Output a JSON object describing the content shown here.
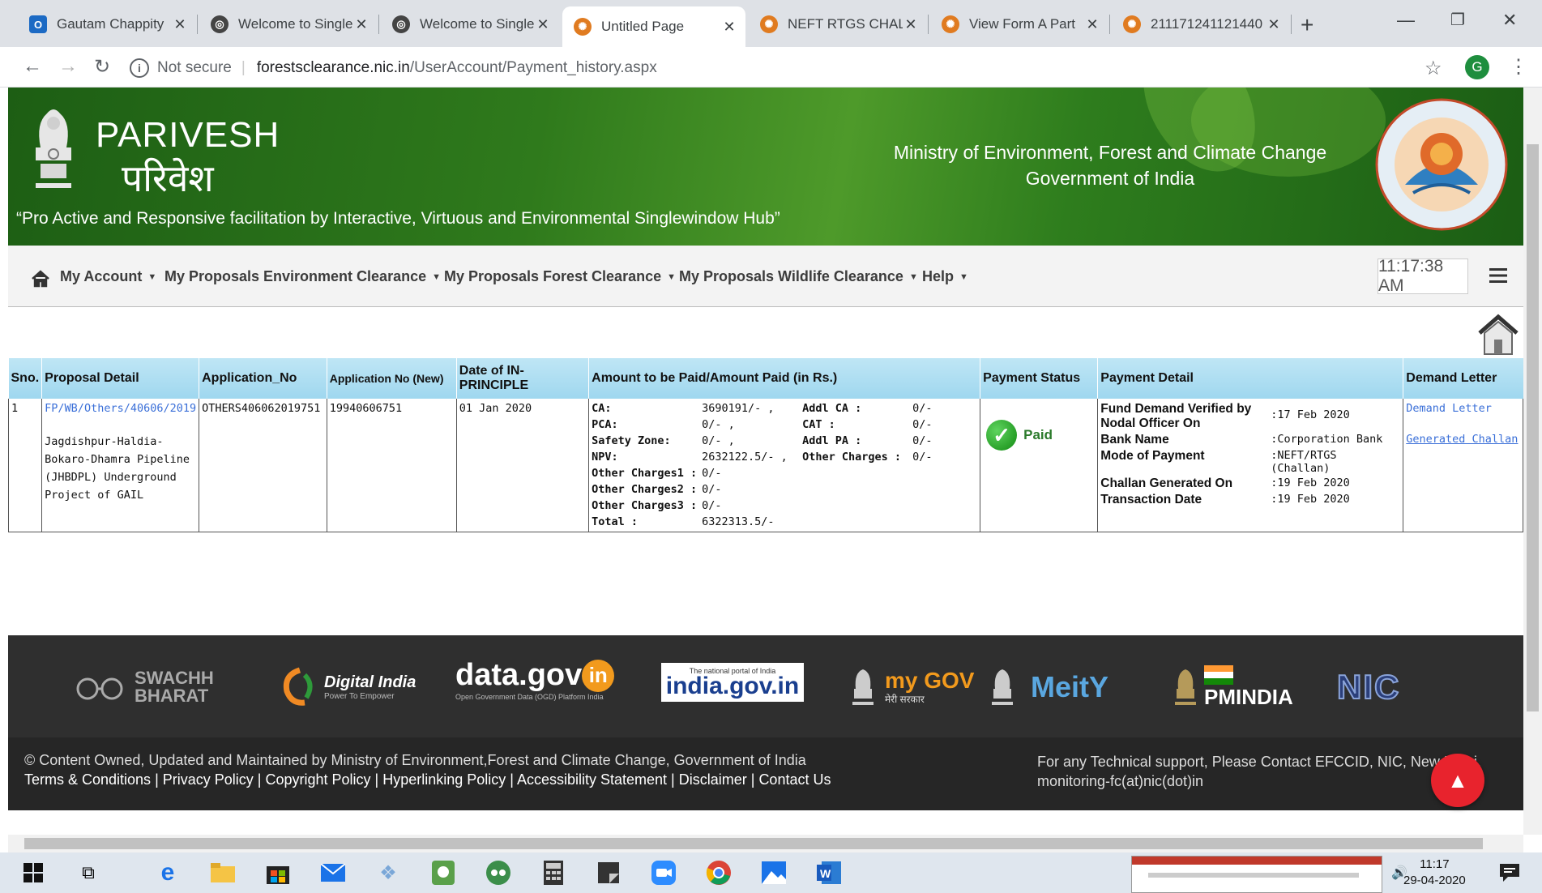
{
  "tabs": [
    {
      "title": "Gautam Chappity",
      "icon_color": "#1c6ac4",
      "icon_glyph": "O"
    },
    {
      "title": "Welcome to Single",
      "icon_color": "#444444",
      "icon_glyph": "◎"
    },
    {
      "title": "Welcome to Single",
      "icon_color": "#444444",
      "icon_glyph": "◎"
    },
    {
      "title": "Untitled Page",
      "icon_color": "#e07b20",
      "icon_glyph": "✺"
    },
    {
      "title": "NEFT RTGS CHALL",
      "icon_color": "#e07b20",
      "icon_glyph": "✺"
    },
    {
      "title": "View Form A Part",
      "icon_color": "#e07b20",
      "icon_glyph": "✺"
    },
    {
      "title": "211171241121440",
      "icon_color": "#e07b20",
      "icon_glyph": "✺"
    }
  ],
  "browser": {
    "security_label": "Not secure",
    "url_host": "forestsclearance.nic.in",
    "url_path": "/UserAccount/Payment_history.aspx",
    "avatar_letter": "G"
  },
  "banner": {
    "brand_en": "PARIVESH",
    "brand_hi": "परिवेश",
    "tagline": "“Pro Active and Responsive facilitation by Interactive, Virtuous and Environmental Singlewindow Hub”",
    "ministry_line1": "Ministry of Environment, Forest and Climate Change",
    "ministry_line2": "Government of India"
  },
  "menu": {
    "items": [
      {
        "label": "My Account"
      },
      {
        "label": "My Proposals Environment Clearance"
      },
      {
        "label": "My Proposals Forest Clearance"
      },
      {
        "label": "My Proposals Wildlife Clearance"
      },
      {
        "label": "Help"
      }
    ],
    "clock": "11:17:38 AM"
  },
  "table": {
    "headers": {
      "sno": "Sno.",
      "proposal": "Proposal Detail",
      "app_no": "Application_No",
      "app_no_new": "Application No (New)",
      "date": "Date of IN-PRINCIPLE",
      "amount": "Amount to be Paid/Amount Paid (in Rs.)",
      "status": "Payment Status",
      "detail": "Payment Detail",
      "demand": "Demand Letter"
    },
    "row": {
      "sno": "1",
      "proposal_link": "FP/WB/Others/40606/2019",
      "proposal_desc": "Jagdishpur-Haldia-Bokaro-Dhamra Pipeline (JHBDPL) Underground Project of GAIL",
      "app_no": "OTHERS406062019751",
      "app_no_new": "19940606751",
      "date": "01 Jan 2020",
      "amounts_left": [
        {
          "k": "CA:",
          "v": "3690191/- ,"
        },
        {
          "k": "PCA:",
          "v": "0/- ,"
        },
        {
          "k": "Safety Zone:",
          "v": "0/- ,"
        },
        {
          "k": "NPV:",
          "v": "2632122.5/- ,"
        },
        {
          "k": "Other Charges1 :",
          "v": "0/-"
        },
        {
          "k": "Other Charges2 :",
          "v": "0/-"
        },
        {
          "k": "Other Charges3 :",
          "v": "0/-"
        },
        {
          "k": "Total :",
          "v": "6322313.5/-"
        }
      ],
      "amounts_right": [
        {
          "k": "Addl CA :",
          "v": "0/-"
        },
        {
          "k": "CAT :",
          "v": "0/-"
        },
        {
          "k": "Addl PA :",
          "v": "0/-"
        },
        {
          "k": "Other Charges :",
          "v": "0/-"
        }
      ],
      "status": "Paid",
      "details": [
        {
          "k": "Fund Demand Verified by Nodal Officer On",
          "v": ":17 Feb 2020"
        },
        {
          "k": "Bank Name",
          "v": ":Corporation Bank"
        },
        {
          "k": "Mode of Payment",
          "v": ":NEFT/RTGS (Challan)"
        },
        {
          "k": "Challan Generated On",
          "v": ":19 Feb 2020"
        },
        {
          "k": "Transaction Date",
          "v": ":19 Feb 2020"
        }
      ],
      "demand_link": "Demand Letter",
      "challan_link": "Generated Challan"
    }
  },
  "footer_logos": {
    "swachh": "SWACHH BHARAT",
    "digital": "Digital India",
    "digital_sub": "Power To Empower",
    "datagov": "data.gov",
    "datagov_in": "in",
    "datagov_sub": "Open Government Data (OGD) Platform India",
    "indiagov_top": "The national portal of India",
    "indiagov": "india.gov.in",
    "mygov": "my GOV",
    "mygov_sub": "मेरी सरकार",
    "meity": "MeitY",
    "pmindia": "PMINDIA",
    "nic": "NIC"
  },
  "footer": {
    "copyright": "© Content Owned, Updated and Maintained by Ministry of Environment,Forest and Climate Change, Government of India",
    "links": [
      "Terms & Conditions",
      "Privacy Policy",
      "Copyright Policy",
      "Hyperlinking Policy",
      "Accessibility Statement",
      "Disclaimer",
      "Contact Us"
    ],
    "support_line1": "For any Technical support, Please Contact EFCCID, NIC, New Delhi,",
    "support_line2": "monitoring-fc(at)nic(dot)in"
  },
  "taskbar": {
    "time": "11:17",
    "date": "29-04-2020"
  }
}
